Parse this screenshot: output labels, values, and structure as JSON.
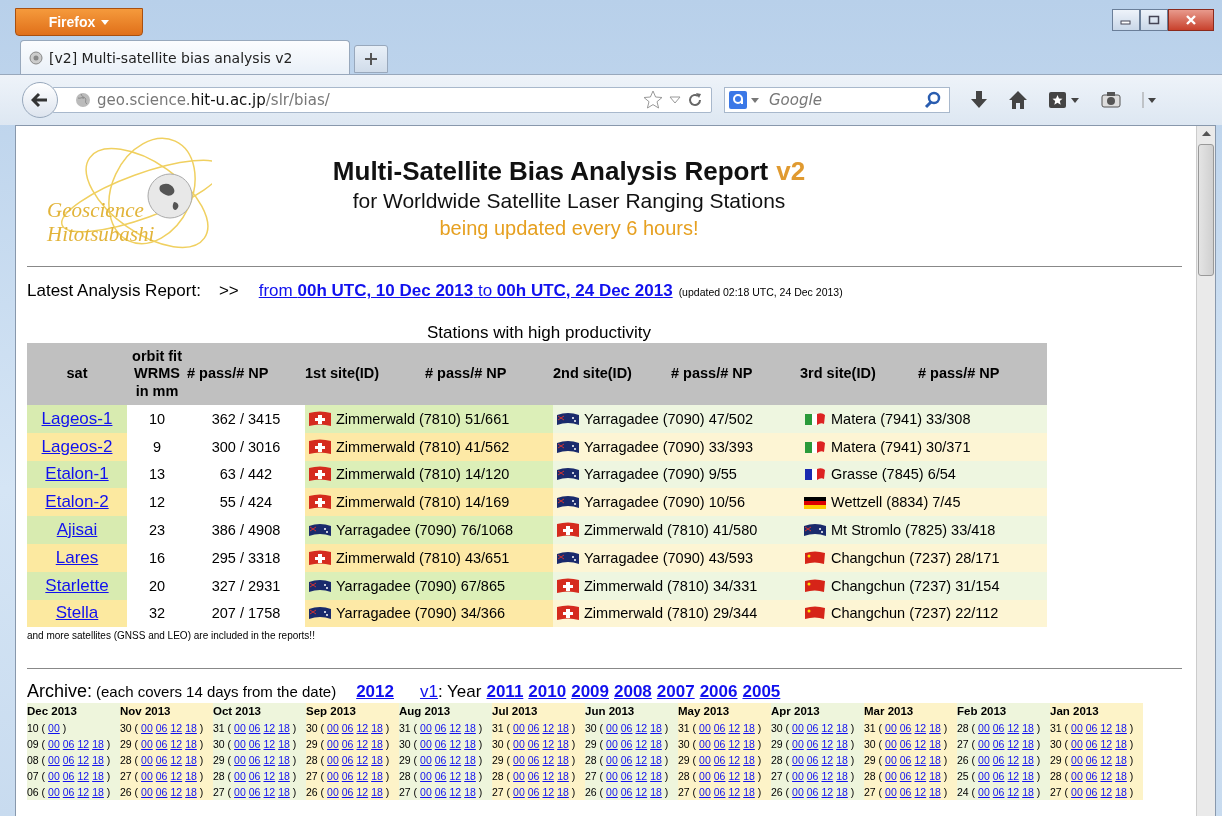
{
  "browser": {
    "menu_button": "Firefox",
    "tab": {
      "title": "[v2] Multi-satellite bias analysis v2"
    },
    "url": {
      "prefix": "geo.science.",
      "domain": "hit-u.ac.jp",
      "path": "/slr/bias/"
    },
    "search": {
      "placeholder": "Google"
    }
  },
  "header": {
    "logo_lines": [
      "Geoscience",
      "Hitotsubashi"
    ],
    "title": "Multi-Satellite Bias Analysis Report",
    "version": "v2",
    "subtitle": "for Worldwide Satellite Laser Ranging Stations",
    "update_note": "being updated every 6 hours!"
  },
  "latest": {
    "label": "Latest Analysis Report:",
    "arrow": ">>",
    "link": "from **00h UTC, 10 Dec 2013** to **00h UTC, 24 Dec 2013**",
    "updated": "(updated 02:18 UTC, 24 Dec 2013)"
  },
  "stations": {
    "title": "Stations with high productivity",
    "columns": [
      "sat",
      "orbit fit\nWRMS\nin mm",
      "# pass/# NP",
      "1st site(ID)",
      "# pass/# NP",
      "2nd site(ID)",
      "# pass/# NP",
      "3rd site(ID)",
      "# pass/# NP"
    ],
    "rows": [
      {
        "sat": "Lageos-1",
        "wrms": "10",
        "pass_np": "362 / 3415",
        "sites": [
          {
            "kind": "switzerland",
            "text": "Zimmerwald (7810) 51/661"
          },
          {
            "kind": "australia",
            "text": "Yarragadee (7090) 47/502"
          },
          {
            "kind": "italy",
            "text": "Matera (7941) 33/308"
          }
        ]
      },
      {
        "sat": "Lageos-2",
        "wrms": "9",
        "pass_np": "300 / 3016",
        "sites": [
          {
            "kind": "switzerland",
            "text": "Zimmerwald (7810) 41/562"
          },
          {
            "kind": "australia",
            "text": "Yarragadee (7090) 33/393"
          },
          {
            "kind": "italy",
            "text": "Matera (7941) 30/371"
          }
        ]
      },
      {
        "sat": "Etalon-1",
        "wrms": "13",
        "pass_np": "63 / 442",
        "sites": [
          {
            "kind": "switzerland",
            "text": "Zimmerwald (7810) 14/120"
          },
          {
            "kind": "australia",
            "text": "Yarragadee (7090) 9/55"
          },
          {
            "kind": "france",
            "text": "Grasse (7845) 6/54"
          }
        ]
      },
      {
        "sat": "Etalon-2",
        "wrms": "12",
        "pass_np": "55 / 424",
        "sites": [
          {
            "kind": "switzerland",
            "text": "Zimmerwald (7810) 14/169"
          },
          {
            "kind": "australia",
            "text": "Yarragadee (7090) 10/56"
          },
          {
            "kind": "germany",
            "text": "Wettzell (8834) 7/45"
          }
        ]
      },
      {
        "sat": "Ajisai",
        "wrms": "23",
        "pass_np": "386 / 4908",
        "sites": [
          {
            "kind": "australia",
            "text": "Yarragadee (7090) 76/1068"
          },
          {
            "kind": "switzerland",
            "text": "Zimmerwald (7810) 41/580"
          },
          {
            "kind": "australia",
            "text": "Mt Stromlo (7825) 33/418"
          }
        ]
      },
      {
        "sat": "Lares",
        "wrms": "16",
        "pass_np": "295 / 3318",
        "sites": [
          {
            "kind": "switzerland",
            "text": "Zimmerwald (7810) 43/651"
          },
          {
            "kind": "australia",
            "text": "Yarragadee (7090) 43/593"
          },
          {
            "kind": "china",
            "text": "Changchun (7237) 28/171"
          }
        ]
      },
      {
        "sat": "Starlette",
        "wrms": "20",
        "pass_np": "327 / 2931",
        "sites": [
          {
            "kind": "australia",
            "text": "Yarragadee (7090) 67/865"
          },
          {
            "kind": "switzerland",
            "text": "Zimmerwald (7810) 34/331"
          },
          {
            "kind": "china",
            "text": "Changchun (7237) 31/154"
          }
        ]
      },
      {
        "sat": "Stella",
        "wrms": "32",
        "pass_np": "207 / 1758",
        "sites": [
          {
            "kind": "australia",
            "text": "Yarragadee (7090) 34/366"
          },
          {
            "kind": "switzerland",
            "text": "Zimmerwald (7810) 29/344"
          },
          {
            "kind": "china",
            "text": "Changchun (7237) 22/112"
          }
        ]
      }
    ],
    "note": "and more satellites (GNSS and LEO) are included in the reports!!"
  },
  "archive": {
    "label": "Archive:",
    "note": "(each covers 14 days from the date)",
    "year_link": "2012",
    "v1_link": "v1",
    "v1_text": ": Year",
    "v1_years": [
      "2011",
      "2010",
      "2009",
      "2008",
      "2007",
      "2006",
      "2005"
    ],
    "brackets": [
      "(",
      ")"
    ],
    "months": [
      {
        "month": "Dec 2013",
        "rows": [
          {
            "day": "10",
            "hours": [
              "00"
            ]
          },
          {
            "day": "09",
            "hours": [
              "00",
              "06",
              "12",
              "18"
            ]
          },
          {
            "day": "08",
            "hours": [
              "00",
              "06",
              "12",
              "18"
            ]
          },
          {
            "day": "07",
            "hours": [
              "00",
              "06",
              "12",
              "18"
            ]
          },
          {
            "day": "06",
            "hours": [
              "00",
              "06",
              "12",
              "18"
            ]
          }
        ]
      },
      {
        "month": "Nov 2013",
        "rows": [
          {
            "day": "30",
            "hours": [
              "00",
              "06",
              "12",
              "18"
            ]
          },
          {
            "day": "29",
            "hours": [
              "00",
              "06",
              "12",
              "18"
            ]
          },
          {
            "day": "28",
            "hours": [
              "00",
              "06",
              "12",
              "18"
            ]
          },
          {
            "day": "27",
            "hours": [
              "00",
              "06",
              "12",
              "18"
            ]
          },
          {
            "day": "26",
            "hours": [
              "00",
              "06",
              "12",
              "18"
            ]
          }
        ]
      },
      {
        "month": "Oct 2013",
        "rows": [
          {
            "day": "31",
            "hours": [
              "00",
              "06",
              "12",
              "18"
            ]
          },
          {
            "day": "30",
            "hours": [
              "00",
              "06",
              "12",
              "18"
            ]
          },
          {
            "day": "29",
            "hours": [
              "00",
              "06",
              "12",
              "18"
            ]
          },
          {
            "day": "28",
            "hours": [
              "00",
              "06",
              "12",
              "18"
            ]
          },
          {
            "day": "27",
            "hours": [
              "00",
              "06",
              "12",
              "18"
            ]
          }
        ]
      },
      {
        "month": "Sep 2013",
        "rows": [
          {
            "day": "30",
            "hours": [
              "00",
              "06",
              "12",
              "18"
            ]
          },
          {
            "day": "29",
            "hours": [
              "00",
              "06",
              "12",
              "18"
            ]
          },
          {
            "day": "28",
            "hours": [
              "00",
              "06",
              "12",
              "18"
            ]
          },
          {
            "day": "27",
            "hours": [
              "00",
              "06",
              "12",
              "18"
            ]
          },
          {
            "day": "26",
            "hours": [
              "00",
              "06",
              "12",
              "18"
            ]
          }
        ]
      },
      {
        "month": "Aug 2013",
        "rows": [
          {
            "day": "31",
            "hours": [
              "00",
              "06",
              "12",
              "18"
            ]
          },
          {
            "day": "30",
            "hours": [
              "00",
              "06",
              "12",
              "18"
            ]
          },
          {
            "day": "29",
            "hours": [
              "00",
              "06",
              "12",
              "18"
            ]
          },
          {
            "day": "28",
            "hours": [
              "00",
              "06",
              "12",
              "18"
            ]
          },
          {
            "day": "27",
            "hours": [
              "00",
              "06",
              "12",
              "18"
            ]
          }
        ]
      },
      {
        "month": "Jul 2013",
        "rows": [
          {
            "day": "31",
            "hours": [
              "00",
              "06",
              "12",
              "18"
            ]
          },
          {
            "day": "30",
            "hours": [
              "00",
              "06",
              "12",
              "18"
            ]
          },
          {
            "day": "29",
            "hours": [
              "00",
              "06",
              "12",
              "18"
            ]
          },
          {
            "day": "28",
            "hours": [
              "00",
              "06",
              "12",
              "18"
            ]
          },
          {
            "day": "27",
            "hours": [
              "00",
              "06",
              "12",
              "18"
            ]
          }
        ]
      },
      {
        "month": "Jun 2013",
        "rows": [
          {
            "day": "30",
            "hours": [
              "00",
              "06",
              "12",
              "18"
            ]
          },
          {
            "day": "29",
            "hours": [
              "00",
              "06",
              "12",
              "18"
            ]
          },
          {
            "day": "28",
            "hours": [
              "00",
              "06",
              "12",
              "18"
            ]
          },
          {
            "day": "27",
            "hours": [
              "00",
              "06",
              "12",
              "18"
            ]
          },
          {
            "day": "26",
            "hours": [
              "00",
              "06",
              "12",
              "18"
            ]
          }
        ]
      },
      {
        "month": "May 2013",
        "rows": [
          {
            "day": "31",
            "hours": [
              "00",
              "06",
              "12",
              "18"
            ]
          },
          {
            "day": "30",
            "hours": [
              "00",
              "06",
              "12",
              "18"
            ]
          },
          {
            "day": "29",
            "hours": [
              "00",
              "06",
              "12",
              "18"
            ]
          },
          {
            "day": "28",
            "hours": [
              "00",
              "06",
              "12",
              "18"
            ]
          },
          {
            "day": "27",
            "hours": [
              "00",
              "06",
              "12",
              "18"
            ]
          }
        ]
      },
      {
        "month": "Apr 2013",
        "rows": [
          {
            "day": "30",
            "hours": [
              "00",
              "06",
              "12",
              "18"
            ]
          },
          {
            "day": "29",
            "hours": [
              "00",
              "06",
              "12",
              "18"
            ]
          },
          {
            "day": "28",
            "hours": [
              "00",
              "06",
              "12",
              "18"
            ]
          },
          {
            "day": "27",
            "hours": [
              "00",
              "06",
              "12",
              "18"
            ]
          },
          {
            "day": "26",
            "hours": [
              "00",
              "06",
              "12",
              "18"
            ]
          }
        ]
      },
      {
        "month": "Mar 2013",
        "rows": [
          {
            "day": "31",
            "hours": [
              "00",
              "06",
              "12",
              "18"
            ]
          },
          {
            "day": "30",
            "hours": [
              "00",
              "06",
              "12",
              "18"
            ]
          },
          {
            "day": "29",
            "hours": [
              "00",
              "06",
              "12",
              "18"
            ]
          },
          {
            "day": "28",
            "hours": [
              "00",
              "06",
              "12",
              "18"
            ]
          },
          {
            "day": "27",
            "hours": [
              "00",
              "06",
              "12",
              "18"
            ]
          }
        ]
      },
      {
        "month": "Feb 2013",
        "rows": [
          {
            "day": "28",
            "hours": [
              "00",
              "06",
              "12",
              "18"
            ]
          },
          {
            "day": "27",
            "hours": [
              "00",
              "06",
              "12",
              "18"
            ]
          },
          {
            "day": "26",
            "hours": [
              "00",
              "06",
              "12",
              "18"
            ]
          },
          {
            "day": "25",
            "hours": [
              "00",
              "06",
              "12",
              "18"
            ]
          },
          {
            "day": "24",
            "hours": [
              "00",
              "06",
              "12",
              "18"
            ]
          }
        ]
      },
      {
        "month": "Jan 2013",
        "rows": [
          {
            "day": "31",
            "hours": [
              "00",
              "06",
              "12",
              "18"
            ]
          },
          {
            "day": "30",
            "hours": [
              "00",
              "06",
              "12",
              "18"
            ]
          },
          {
            "day": "29",
            "hours": [
              "00",
              "06",
              "12",
              "18"
            ]
          },
          {
            "day": "28",
            "hours": [
              "00",
              "06",
              "12",
              "18"
            ]
          },
          {
            "day": "27",
            "hours": [
              "00",
              "06",
              "12",
              "18"
            ]
          }
        ]
      }
    ]
  }
}
